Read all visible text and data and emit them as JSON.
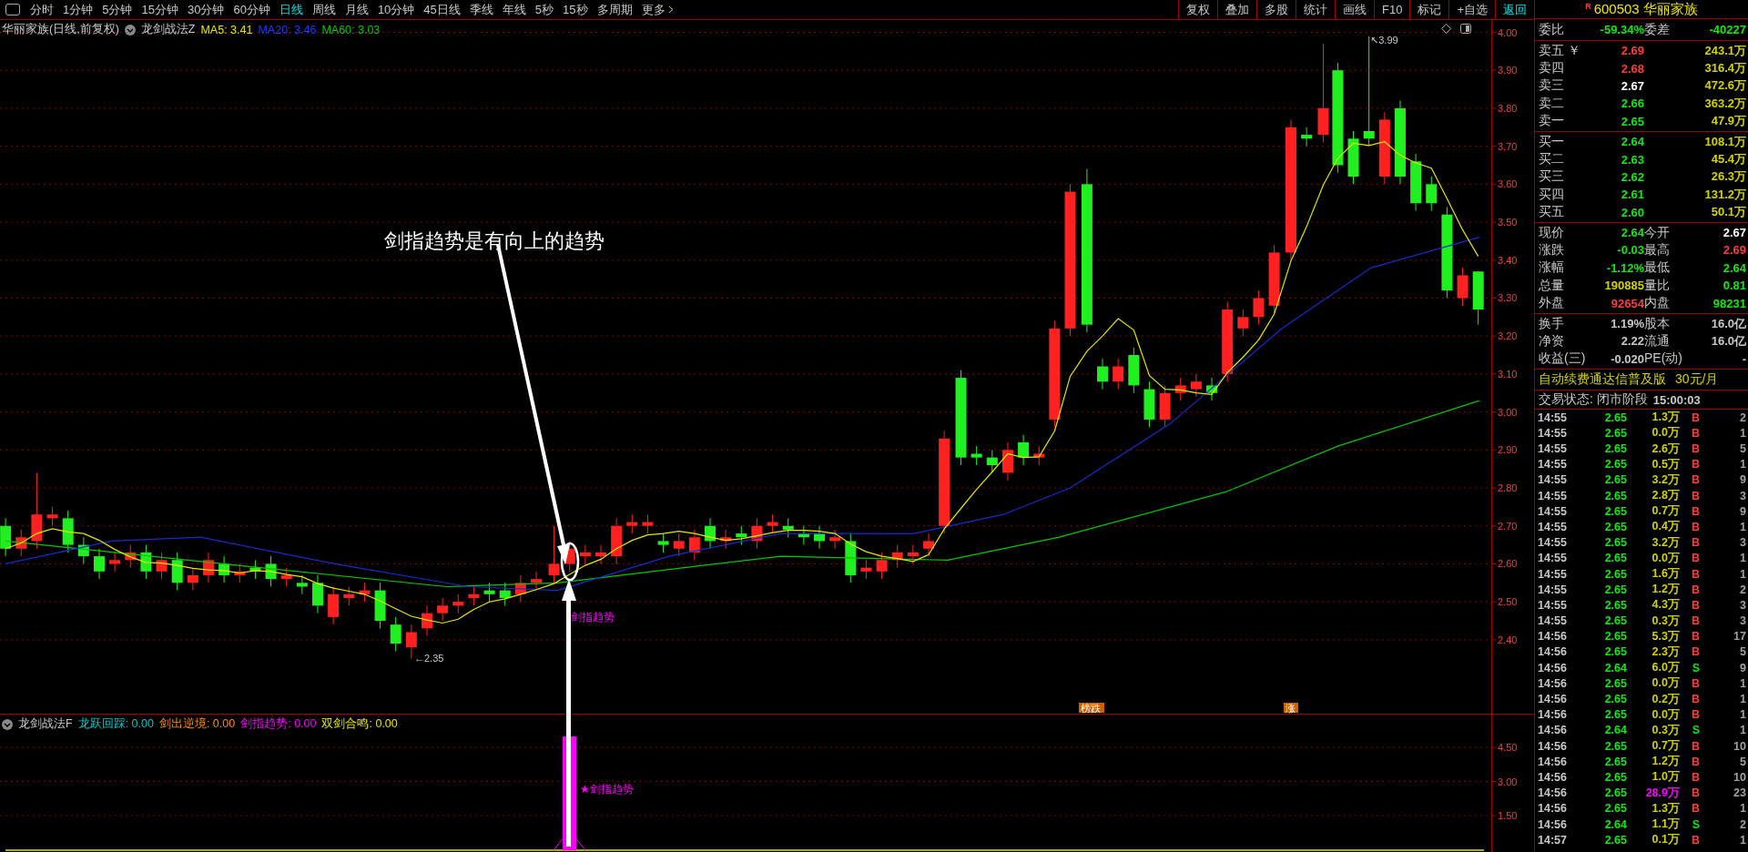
{
  "toolbar": {
    "periods": [
      {
        "label": "分时",
        "selected": false
      },
      {
        "label": "1分钟",
        "selected": false
      },
      {
        "label": "5分钟",
        "selected": false
      },
      {
        "label": "15分钟",
        "selected": false
      },
      {
        "label": "30分钟",
        "selected": false
      },
      {
        "label": "60分钟",
        "selected": false
      },
      {
        "label": "日线",
        "selected": true
      },
      {
        "label": "周线",
        "selected": false
      },
      {
        "label": "月线",
        "selected": false
      },
      {
        "label": "10分钟",
        "selected": false
      },
      {
        "label": "45日线",
        "selected": false
      },
      {
        "label": "季线",
        "selected": false
      },
      {
        "label": "年线",
        "selected": false
      },
      {
        "label": "5秒",
        "selected": false
      },
      {
        "label": "15秒",
        "selected": false
      },
      {
        "label": "多周期",
        "selected": false
      }
    ],
    "more": "更多",
    "actions": [
      {
        "label": "复权",
        "highlighted": false
      },
      {
        "label": "叠加",
        "highlighted": false
      },
      {
        "label": "多股",
        "highlighted": false
      },
      {
        "label": "统计",
        "highlighted": false
      },
      {
        "label": "画线",
        "highlighted": false
      },
      {
        "label": "F10",
        "highlighted": false
      },
      {
        "label": "标记",
        "highlighted": false
      },
      {
        "label": "+自选",
        "highlighted": false
      },
      {
        "label": "返回",
        "highlighted": true
      }
    ]
  },
  "main_chart": {
    "title": "华丽家族(日线,前复权)",
    "formula": "龙剑战法Z",
    "indicators": [
      {
        "text": "MA5: 3.41",
        "color": "#e6e600"
      },
      {
        "text": "MA20: 3.46",
        "color": "#1a3cff"
      },
      {
        "text": "MA60: 3.03",
        "color": "#00c800"
      }
    ],
    "yticks": [
      "4.00",
      "3.90",
      "3.80",
      "3.70",
      "3.60",
      "3.50",
      "3.40",
      "3.30",
      "3.20",
      "3.10",
      "3.00",
      "2.90",
      "2.80",
      "2.70",
      "2.60",
      "2.50",
      "2.40"
    ],
    "callout": "剑指趋势是有向上的趋势",
    "signal_label": "剑指趋势",
    "low_label": "←2.35",
    "high_label": "↖3.99",
    "tags": [
      "榜跌",
      "涨"
    ]
  },
  "indicator_chart": {
    "formula": "龙剑战法F",
    "values": [
      {
        "text": "龙跃回踩: 0.00",
        "color": "#00c8c8"
      },
      {
        "text": "剑出逆境: 0.00",
        "color": "#ff8c00"
      },
      {
        "text": "剑指趋势: 0.00",
        "color": "#ff00ff"
      },
      {
        "text": "双剑合鸣: 0.00",
        "color": "#e6e600"
      }
    ],
    "yticks": [
      "4.50",
      "3.00",
      "1.50"
    ],
    "bar_label": "★剑指趋势"
  },
  "quote": {
    "badge": "R",
    "code": "600503",
    "name": "华丽家族",
    "ratio": {
      "label": "委比",
      "value": "-59.34%",
      "label2": "委差",
      "value2": "-40227"
    },
    "sell": [
      {
        "label": "卖五",
        "currency": "￥",
        "price": "2.69",
        "volume": "243.1万",
        "color": "#ff3c3c"
      },
      {
        "label": "卖四",
        "price": "2.68",
        "volume": "316.4万",
        "color": "#ff3c3c"
      },
      {
        "label": "卖三",
        "price": "2.67",
        "volume": "472.6万",
        "color": "#ffffff"
      },
      {
        "label": "卖二",
        "price": "2.66",
        "volume": "363.2万",
        "color": "#14e614"
      },
      {
        "label": "卖一",
        "price": "2.65",
        "volume": "47.9万",
        "color": "#14e614"
      }
    ],
    "buy": [
      {
        "label": "买一",
        "price": "2.64",
        "volume": "108.1万",
        "color": "#14e614"
      },
      {
        "label": "买二",
        "price": "2.63",
        "volume": "45.4万",
        "color": "#14e614"
      },
      {
        "label": "买三",
        "price": "2.62",
        "volume": "26.3万",
        "color": "#14e614"
      },
      {
        "label": "买四",
        "price": "2.61",
        "volume": "131.2万",
        "color": "#14e614"
      },
      {
        "label": "买五",
        "price": "2.60",
        "volume": "50.1万",
        "color": "#14e614"
      }
    ],
    "details": [
      [
        {
          "label": "现价",
          "value": "2.64",
          "color": "#14e614"
        },
        {
          "label": "今开",
          "value": "2.67",
          "color": "#ffffff"
        }
      ],
      [
        {
          "label": "涨跌",
          "value": "-0.03",
          "color": "#14e614"
        },
        {
          "label": "最高",
          "value": "2.69",
          "color": "#ff3c3c"
        }
      ],
      [
        {
          "label": "涨幅",
          "value": "-1.12%",
          "color": "#14e614"
        },
        {
          "label": "最低",
          "value": "2.64",
          "color": "#14e614"
        }
      ],
      [
        {
          "label": "总量",
          "value": "190885",
          "color": "#d2d200"
        },
        {
          "label": "量比",
          "value": "0.81",
          "color": "#14e614"
        }
      ],
      [
        {
          "label": "外盘",
          "value": "92654",
          "color": "#ff3c3c"
        },
        {
          "label": "内盘",
          "value": "98231",
          "color": "#14e614"
        }
      ]
    ],
    "stats": [
      {
        "label": "换手",
        "value": "1.19%",
        "label2": "股本",
        "value2": "16.0亿"
      },
      {
        "label": "净资",
        "value": "2.22",
        "label2": "流通",
        "value2": "16.0亿"
      },
      {
        "label": "收益(三)",
        "value": "-0.020",
        "label2": "PE(动)",
        "value2": "-"
      }
    ],
    "promo": "自动续费通达信普及版",
    "promo_price": "30元/月",
    "status": "交易状态: 闭市阶段",
    "status_time": "15:00:03",
    "trades": [
      {
        "time": "14:55",
        "price": "2.65",
        "volume": "1.3万",
        "side": "B",
        "kind": "buy",
        "large": false,
        "count": "2"
      },
      {
        "time": "14:55",
        "price": "2.65",
        "volume": "0.0万",
        "side": "B",
        "kind": "buy",
        "large": false,
        "count": "1"
      },
      {
        "time": "14:55",
        "price": "2.65",
        "volume": "2.6万",
        "side": "B",
        "kind": "buy",
        "large": false,
        "count": "5"
      },
      {
        "time": "14:55",
        "price": "2.65",
        "volume": "0.5万",
        "side": "B",
        "kind": "buy",
        "large": false,
        "count": "1"
      },
      {
        "time": "14:55",
        "price": "2.65",
        "volume": "3.2万",
        "side": "B",
        "kind": "buy",
        "large": false,
        "count": "9"
      },
      {
        "time": "14:55",
        "price": "2.65",
        "volume": "2.8万",
        "side": "B",
        "kind": "buy",
        "large": false,
        "count": "3"
      },
      {
        "time": "14:55",
        "price": "2.65",
        "volume": "0.7万",
        "side": "B",
        "kind": "buy",
        "large": false,
        "count": "9"
      },
      {
        "time": "14:55",
        "price": "2.65",
        "volume": "0.4万",
        "side": "B",
        "kind": "buy",
        "large": false,
        "count": "1"
      },
      {
        "time": "14:55",
        "price": "2.65",
        "volume": "3.2万",
        "side": "B",
        "kind": "buy",
        "large": false,
        "count": "3"
      },
      {
        "time": "14:55",
        "price": "2.65",
        "volume": "0.0万",
        "side": "B",
        "kind": "buy",
        "large": false,
        "count": "1"
      },
      {
        "time": "14:55",
        "price": "2.65",
        "volume": "1.6万",
        "side": "B",
        "kind": "buy",
        "large": false,
        "count": "1"
      },
      {
        "time": "14:55",
        "price": "2.65",
        "volume": "1.2万",
        "side": "B",
        "kind": "buy",
        "large": false,
        "count": "2"
      },
      {
        "time": "14:55",
        "price": "2.65",
        "volume": "4.3万",
        "side": "B",
        "kind": "buy",
        "large": false,
        "count": "3"
      },
      {
        "time": "14:55",
        "price": "2.65",
        "volume": "0.3万",
        "side": "B",
        "kind": "buy",
        "large": false,
        "count": "3"
      },
      {
        "time": "14:56",
        "price": "2.65",
        "volume": "5.3万",
        "side": "B",
        "kind": "buy",
        "large": false,
        "count": "17"
      },
      {
        "time": "14:56",
        "price": "2.65",
        "volume": "2.3万",
        "side": "B",
        "kind": "buy",
        "large": false,
        "count": "5"
      },
      {
        "time": "14:56",
        "price": "2.64",
        "volume": "6.0万",
        "side": "S",
        "kind": "sell",
        "large": false,
        "count": "9"
      },
      {
        "time": "14:56",
        "price": "2.65",
        "volume": "0.0万",
        "side": "B",
        "kind": "buy",
        "large": false,
        "count": "1"
      },
      {
        "time": "14:56",
        "price": "2.65",
        "volume": "0.2万",
        "side": "B",
        "kind": "buy",
        "large": false,
        "count": "1"
      },
      {
        "time": "14:56",
        "price": "2.65",
        "volume": "0.0万",
        "side": "B",
        "kind": "buy",
        "large": false,
        "count": "1"
      },
      {
        "time": "14:56",
        "price": "2.64",
        "volume": "0.3万",
        "side": "S",
        "kind": "sell",
        "large": false,
        "count": "1"
      },
      {
        "time": "14:56",
        "price": "2.65",
        "volume": "0.7万",
        "side": "B",
        "kind": "buy",
        "large": false,
        "count": "10"
      },
      {
        "time": "14:56",
        "price": "2.65",
        "volume": "1.2万",
        "side": "B",
        "kind": "buy",
        "large": false,
        "count": "5"
      },
      {
        "time": "14:56",
        "price": "2.65",
        "volume": "1.0万",
        "side": "B",
        "kind": "buy",
        "large": false,
        "count": "10"
      },
      {
        "time": "14:56",
        "price": "2.65",
        "volume": "28.9万",
        "side": "B",
        "kind": "buy",
        "large": true,
        "count": "23"
      },
      {
        "time": "14:56",
        "price": "2.65",
        "volume": "1.3万",
        "side": "B",
        "kind": "buy",
        "large": false,
        "count": "1"
      },
      {
        "time": "14:56",
        "price": "2.64",
        "volume": "1.1万",
        "side": "S",
        "kind": "sell",
        "large": false,
        "count": "2"
      },
      {
        "time": "14:57",
        "price": "2.65",
        "volume": "0.1万",
        "side": "B",
        "kind": "buy",
        "large": false,
        "count": "1"
      }
    ]
  }
}
